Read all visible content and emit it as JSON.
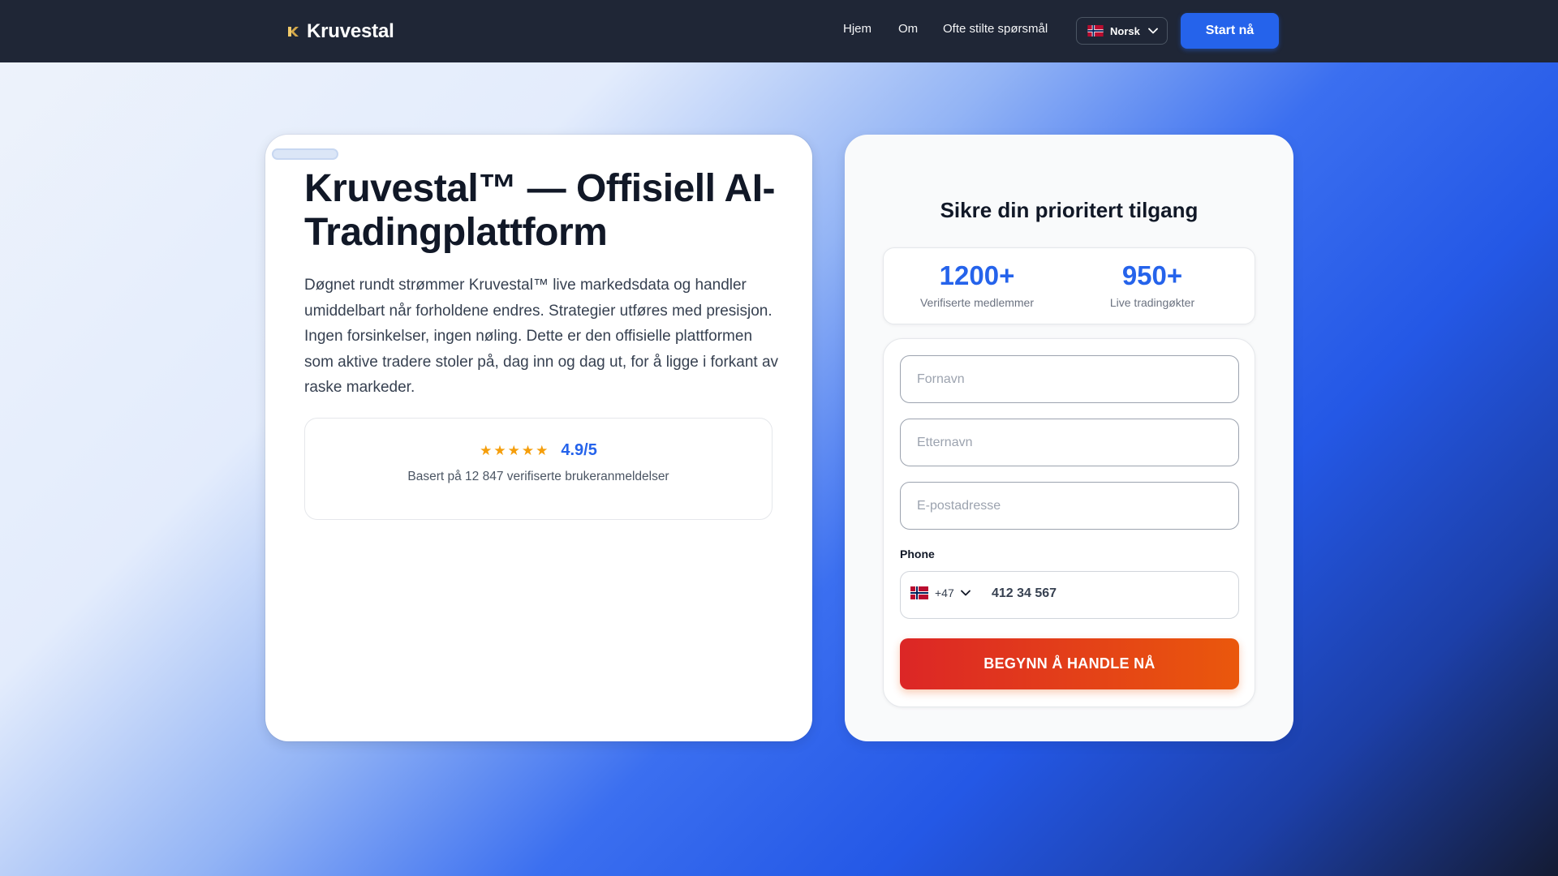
{
  "header": {
    "brand_name": "Kruvestal",
    "nav": [
      {
        "label": "Hjem"
      },
      {
        "label": "Om"
      },
      {
        "label": "Ofte stilte spørsmål"
      }
    ],
    "language": {
      "label": "Norsk",
      "flag": "norway-flag-icon"
    },
    "cta_label": "Start nå"
  },
  "hero": {
    "title": "Kruvestal™ — Offisiell AI-Tradingplattform",
    "description": "Døgnet rundt strømmer Kruvestal™ live markedsdata og handler umiddelbart når forholdene endres. Strategier utføres med presisjon. Ingen forsinkelser, ingen nøling. Dette er den offisielle plattformen som aktive tradere stoler på, dag inn og dag ut, for å ligge i forkant av raske markeder.",
    "rating": {
      "stars": "★★★★★",
      "score": "4.9/5",
      "subtitle": "Basert på 12 847 verifiserte brukeranmeldelser"
    }
  },
  "form": {
    "heading": "Sikre din prioritert tilgang",
    "stats": [
      {
        "value": "1200+",
        "label": "Verifiserte medlemmer"
      },
      {
        "value": "950+",
        "label": "Live tradingøkter"
      }
    ],
    "first_name_placeholder": "Fornavn",
    "last_name_placeholder": "Etternavn",
    "email_placeholder": "E-postadresse",
    "phone_label": "Phone",
    "dial_code": "+47",
    "phone_value": "412 34 567",
    "submit_label": "BEGYNN Å HANDLE NÅ"
  },
  "colors": {
    "header_bg": "#1f2636",
    "accent": "#2563eb",
    "cta_gradient_start": "#dc2626",
    "cta_gradient_end": "#ea580c",
    "star": "#f59e0b"
  }
}
